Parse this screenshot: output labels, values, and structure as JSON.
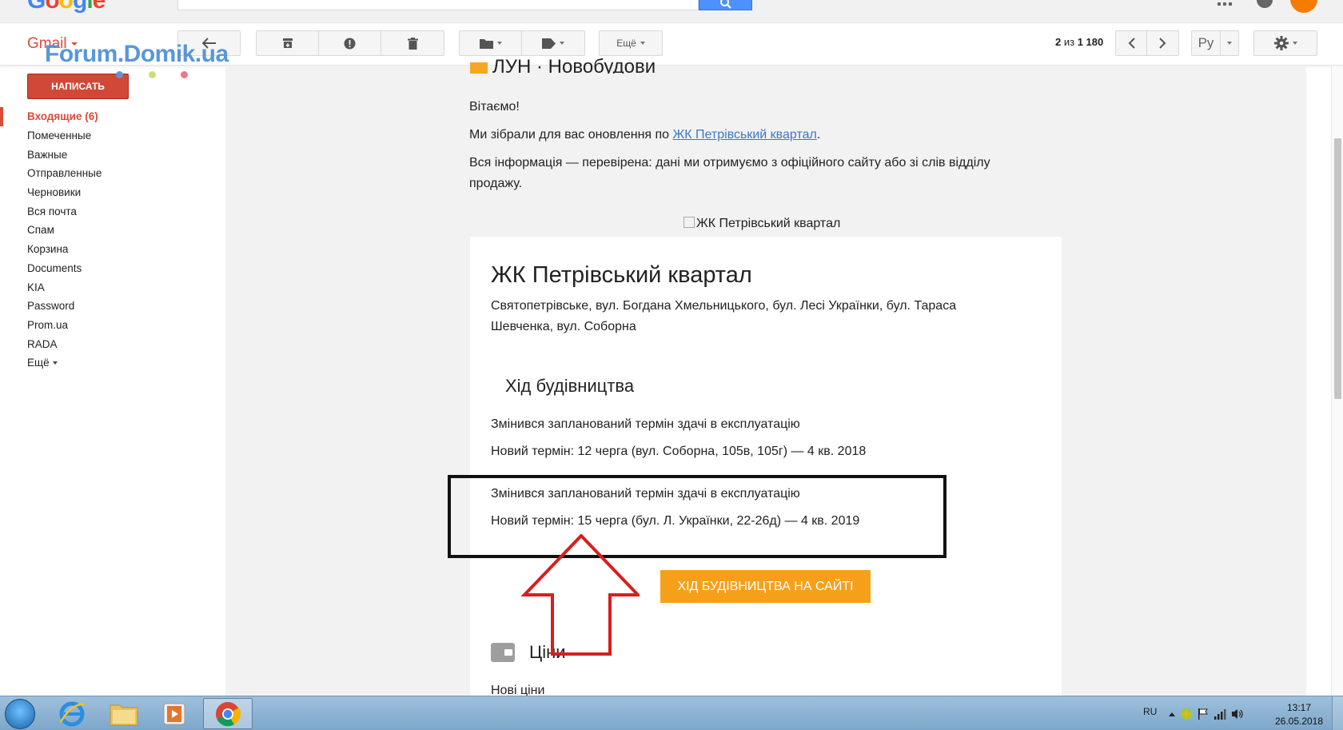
{
  "topbar": {
    "logo_text": "Google",
    "logo_colors": [
      "#4285f4",
      "#ea4335",
      "#fbbc05",
      "#4285f4",
      "#34a853",
      "#ea4335"
    ]
  },
  "toolbar": {
    "gmail_label": "Gmail",
    "more_label": "Ещё",
    "pager_current": "2",
    "pager_sep": "из",
    "pager_total": "1 180",
    "language_label": "Ру"
  },
  "watermark": {
    "text": "Forum.Domik.ua",
    "color": "#4a8fd8"
  },
  "sidebar": {
    "compose_label": "НАПИСАТЬ",
    "items": [
      {
        "label": "Входящие (6)",
        "active": true
      },
      {
        "label": "Помеченные"
      },
      {
        "label": "Важные"
      },
      {
        "label": "Отправленные"
      },
      {
        "label": "Черновики"
      },
      {
        "label": "Вся почта"
      },
      {
        "label": "Спам"
      },
      {
        "label": "Корзина"
      },
      {
        "label": "Documents"
      },
      {
        "label": "KIA"
      },
      {
        "label": "Password"
      },
      {
        "label": "Prom.ua"
      },
      {
        "label": "RADA"
      },
      {
        "label": "Ещё"
      }
    ]
  },
  "email": {
    "header_partial": "ЛУН · Новобудови",
    "greeting": "Вітаємо!",
    "intro_prefix": "Ми зібрали для вас оновлення по ",
    "intro_link": "ЖК Петрівський квартал",
    "intro_suffix": ".",
    "verified_text": "Вся інформація — перевірена: дані ми отримуємо з офіційного сайту або зі слів відділу продажу.",
    "image_alt": "ЖК Петрівський квартал",
    "complex_title": "ЖК Петрівський квартал",
    "address": "Святопетрівське, вул. Богдана Хмельницького, бул. Лесі Українки, бул. Тараса Шевченка, вул. Соборна",
    "construction_heading": "Хід будівництва",
    "changes": [
      {
        "title": "Змінився запланований термін здачі в експлуатацію",
        "detail": "Новий термін: 12 черга (вул. Соборна, 105в, 105г) — 4 кв. 2018"
      },
      {
        "title": "Змінився запланований термін здачі в експлуатацію",
        "detail": "Новий термін: 15 черга (бул. Л. Українки, 22-26д) — 4 кв. 2019"
      }
    ],
    "cta_label": "ХІД БУДІВНИЦТВА НА САЙТІ",
    "cta_color": "#f6a01a",
    "prices_heading": "Ціни",
    "new_prices": "Нові ціни"
  },
  "taskbar": {
    "language": "RU",
    "time": "13:17",
    "date": "26.05.2018",
    "apps": [
      "start-orb",
      "internet-explorer-icon",
      "file-explorer-icon",
      "media-player-icon",
      "chrome-icon"
    ]
  },
  "colors": {
    "gmail_red": "#dd4b39",
    "compose_red": "#d14836",
    "link_blue": "#3b78c4",
    "annotation_red": "#d81e1e",
    "annotation_box": "#111111"
  }
}
